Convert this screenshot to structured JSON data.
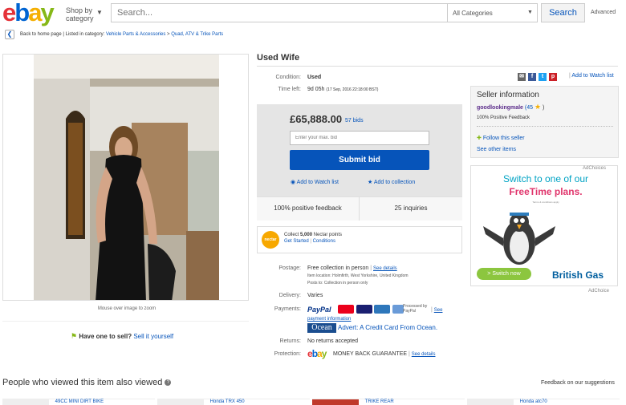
{
  "header": {
    "logo_letters": [
      "e",
      "b",
      "a",
      "y"
    ],
    "shop_by": [
      "Shop by",
      "category"
    ],
    "search_placeholder": "Search...",
    "category_select": "All Categories",
    "search_button": "Search",
    "advanced": "Advanced",
    "brand_colors": {
      "e": "#e53238",
      "b": "#0064d2",
      "a": "#f5af02",
      "y": "#86b817"
    }
  },
  "breadcrumb": {
    "back": "Back to home page",
    "listed": "Listed in category:",
    "items": [
      "Vehicle Parts & Accessories",
      "Quad, ATV & Trike Parts"
    ]
  },
  "gallery": {
    "caption": "Mouse over image to zoom",
    "have_one": "Have one to sell?",
    "sell_link": "Sell it yourself"
  },
  "item": {
    "title": "Used Wife",
    "condition_label": "Condition:",
    "condition": "Used",
    "time_left_label": "Time left:",
    "time_left": "9d 05h",
    "time_end": "(17 Sep, 2016  22:18:00 BST)",
    "add_watch": "Add to Watch list"
  },
  "bid": {
    "price": "£65,888.00",
    "bids": "57 bids",
    "max_placeholder": "Enter your max. bid",
    "submit": "Submit bid",
    "watch": "Add to Watch list",
    "collection": "Add to collection",
    "feedback": "100% positive feedback",
    "inquiries": "25 inquiries"
  },
  "nectar": {
    "logo": "nectar",
    "line1_pre": "Collect ",
    "line1_bold": "5,000",
    "line1_post": " Nectar points",
    "get_started": "Get Started",
    "conditions": "Conditions"
  },
  "seller": {
    "heading": "Seller information",
    "name": "goodlookingmale",
    "score": "(45",
    "score_end": ")",
    "positive": "100% Positive Feedback",
    "follow": "Follow this seller",
    "other": "See other items"
  },
  "ad": {
    "adchoices": "AdChoices",
    "line1": "Switch to one of our",
    "line2": "FreeTime plans.",
    "small": "Terms & conditions apply",
    "button": "> Switch now",
    "brand": "British Gas",
    "adchoices2": "AdChoice"
  },
  "shipping": {
    "postage_label": "Postage:",
    "postage": "Free collection in person",
    "see_details": "See details",
    "location": "Item location:  Holmfirth, West Yorkshire, United Kingdom",
    "posts_to": "Posts to:  Collection in person only",
    "delivery_label": "Delivery:",
    "delivery": "Varies",
    "payments_label": "Payments:",
    "paypal": "PayPal",
    "processed": "Processed by PayPal",
    "see": "See",
    "payment_info": "payment information",
    "ocean_logo": "Ocean",
    "ocean_advert": "Advert: A Credit Card From Ocean.",
    "returns_label": "Returns:",
    "returns": "No returns accepted",
    "protection_label": "Protection:",
    "mbg": "MONEY BACK GUARANTEE",
    "mbg_details": "See details"
  },
  "also_viewed": {
    "heading": "People who viewed this item also viewed",
    "feedback": "Feedback on our suggestions",
    "items": [
      "49CC MINI DIRT BIKE",
      "Honda TRX 450",
      "TRIKE REAR",
      "Honda atc70"
    ]
  }
}
